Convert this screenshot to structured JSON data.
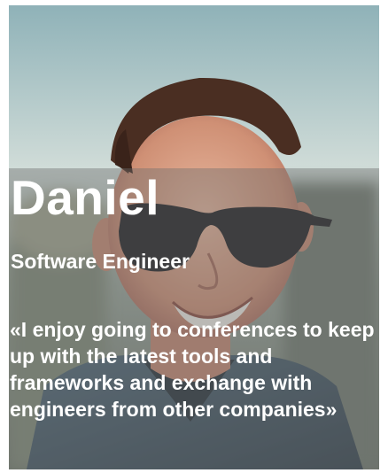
{
  "profile": {
    "name": "Daniel",
    "role": "Software Engineer",
    "quote": "«I enjoy going to conferences to keep up with the latest tools and frameworks and exchange with engineers from other companies»"
  },
  "icons": {
    "photo": "portrait-photo"
  },
  "colors": {
    "text": "#ffffff",
    "overlay": "#6e6e6e"
  }
}
